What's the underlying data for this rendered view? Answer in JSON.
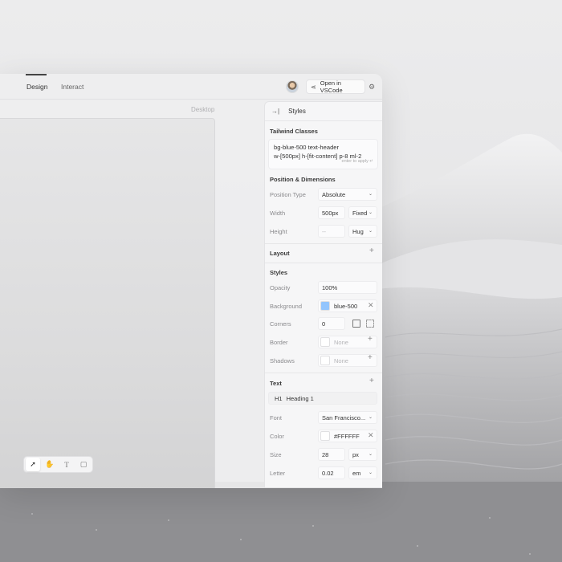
{
  "tabs": [
    {
      "label": "Design",
      "active": true
    },
    {
      "label": "Interact",
      "active": false
    }
  ],
  "header": {
    "open_vscode_label": "Open in VSCode",
    "icons": [
      "share-icon",
      "gear-icon"
    ]
  },
  "canvas": {
    "frame_label": "Desktop",
    "tools": [
      "pointer-icon",
      "hand-icon",
      "text-icon",
      "frame-icon"
    ],
    "active_tool": "pointer-icon"
  },
  "panel": {
    "title": "Styles",
    "tailwind": {
      "title": "Tailwind Classes",
      "line1": "bg-blue-500 text-header",
      "line2": "w-[500px] h-[fit-content] p-8 ml-2",
      "hint": "enter to apply ↵"
    },
    "position": {
      "title": "Position & Dimensions",
      "type_label": "Position Type",
      "type_value": "Absolute",
      "width_label": "Width",
      "width_value": "500px",
      "width_mode": "Fixed",
      "height_label": "Height",
      "height_value": "--",
      "height_mode": "Hug"
    },
    "layout": {
      "title": "Layout"
    },
    "styles": {
      "title": "Styles",
      "opacity_label": "Opacity",
      "opacity_value": "100%",
      "background_label": "Background",
      "background_value": "blue-500",
      "background_color": "#93c5fd",
      "corners_label": "Corners",
      "corners_value": "0",
      "border_label": "Border",
      "border_value": "None",
      "shadows_label": "Shadows",
      "shadows_value": "None"
    },
    "text": {
      "title": "Text",
      "heading_tag": "H1",
      "heading_value": "Heading 1",
      "font_label": "Font",
      "font_value": "San Francisco...",
      "color_label": "Color",
      "color_value": "#FFFFFF",
      "size_label": "Size",
      "size_value": "28",
      "size_unit": "px",
      "letter_label": "Letter",
      "letter_value": "0.02",
      "letter_unit": "em"
    }
  }
}
